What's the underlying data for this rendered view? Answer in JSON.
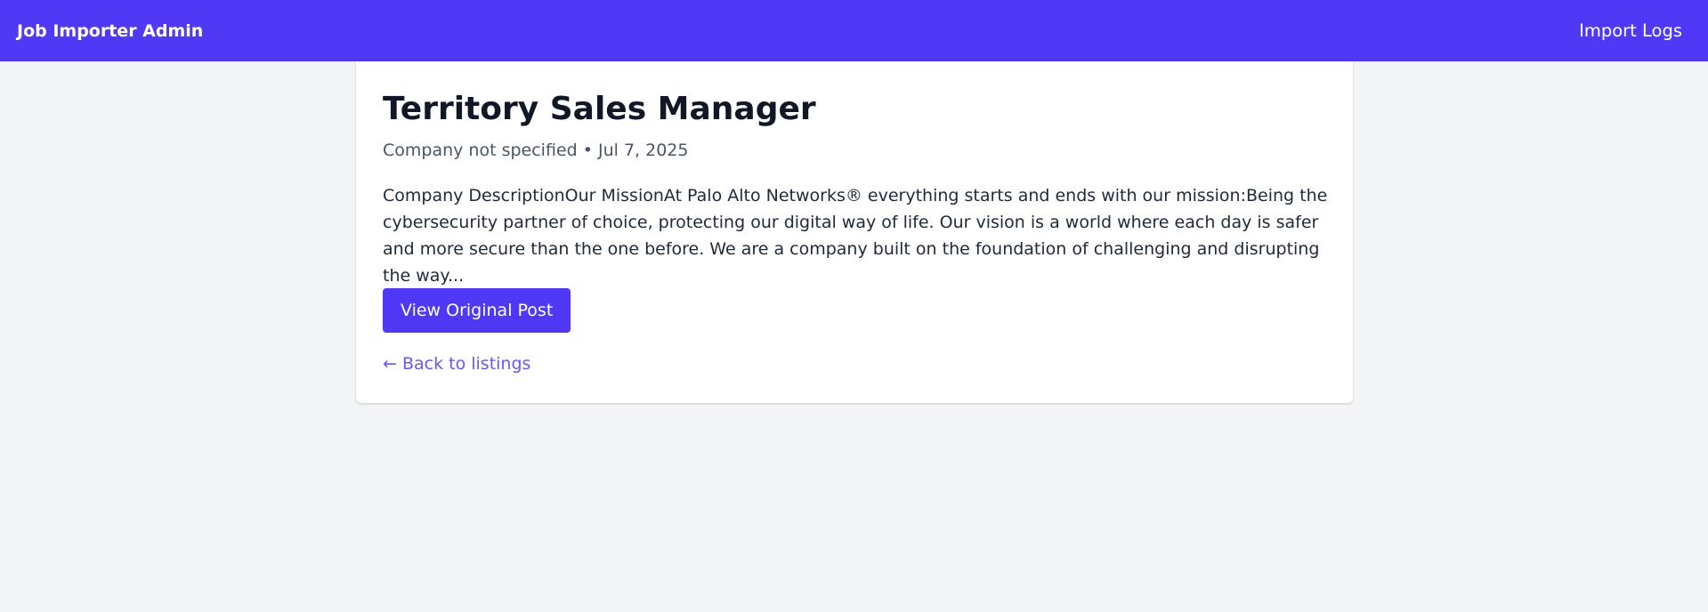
{
  "navbar": {
    "brand": "Job Importer Admin",
    "link": "Import Logs"
  },
  "job": {
    "title": "Territory Sales Manager",
    "company": "Company not specified",
    "separator": "•",
    "date": "Jul 7, 2025",
    "description": "Company DescriptionOur MissionAt Palo Alto Networks® everything starts and ends with our mission:Being the cybersecurity partner of choice, protecting our digital way of life. Our vision is a world where each day is safer and more secure than the one before. We are a company built on the foundation of challenging and disrupting the way...",
    "view_button": "View Original Post",
    "back_link": "← Back to listings"
  },
  "colors": {
    "accent": "#4f39f6",
    "background": "#f3f4f6",
    "card": "#ffffff",
    "title": "#101828",
    "meta": "#4a5565",
    "body_text": "#1e2939"
  }
}
